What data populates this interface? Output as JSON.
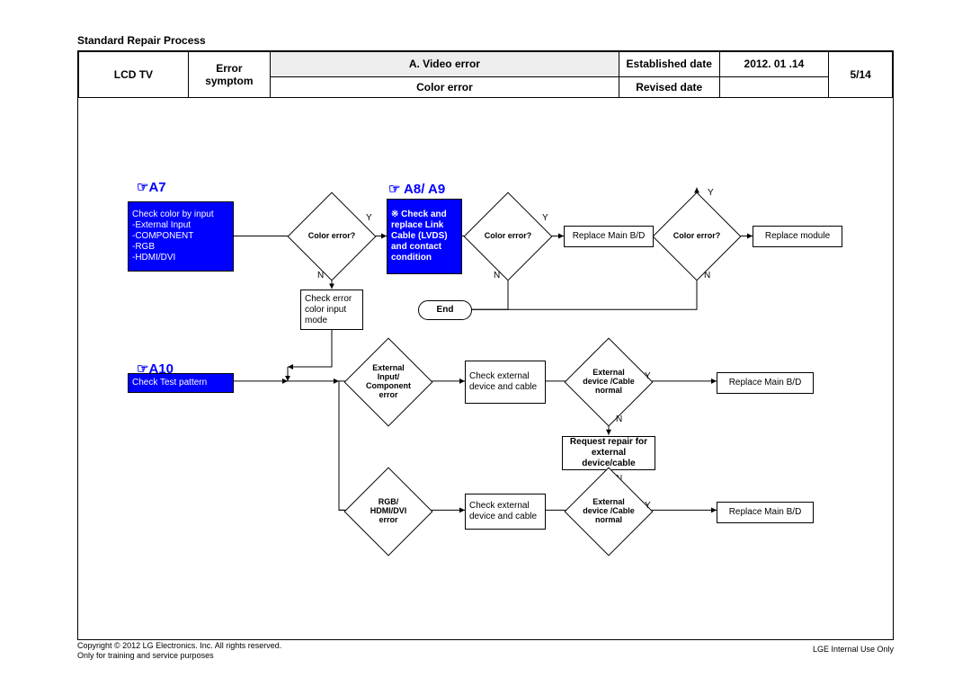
{
  "doc_title": "Standard Repair Process",
  "header": {
    "product": "LCD  TV",
    "error_symptom_label": "Error symptom",
    "main_title": "A. Video error",
    "sub_title": "Color error",
    "established_label": "Established date",
    "established_value": "2012. 01 .14",
    "revised_label": "Revised date",
    "revised_value": "",
    "page": "5/14"
  },
  "sections": {
    "a7": "☞A7",
    "a8_a9": "☞ A8/ A9",
    "a10": "☞A10"
  },
  "nodes": {
    "start1": "Check color by input\n-External Input\n-COMPONENT\n-RGB\n-HDMI/DVI",
    "d1": "Color error?",
    "action1": "※ Check and replace Link Cable (LVDS) and contact condition",
    "d2": "Color error?",
    "repl_main1": "Replace Main B/D",
    "d3": "Color error?",
    "repl_module": "Replace module",
    "check_color_mode": "Check error color input mode",
    "end": "End",
    "start2": "Check Test pattern",
    "d4": "External Input/ Component error",
    "check_ext1": "Check external device and cable",
    "d5": "External device /Cable normal",
    "repl_main2": "Replace Main B/D",
    "req_repair": "Request repair for external device/cable",
    "d6": "RGB/ HDMI/DVI error",
    "check_ext2": "Check external device and cable",
    "d7": "External device /Cable normal",
    "repl_main3": "Replace Main B/D"
  },
  "labels": {
    "Y": "Y",
    "N": "N"
  },
  "footer": {
    "copyright": "Copyright © 2012 LG Electronics. Inc. All rights reserved.",
    "purpose": "Only for training and service purposes",
    "right": "LGE Internal Use Only"
  }
}
